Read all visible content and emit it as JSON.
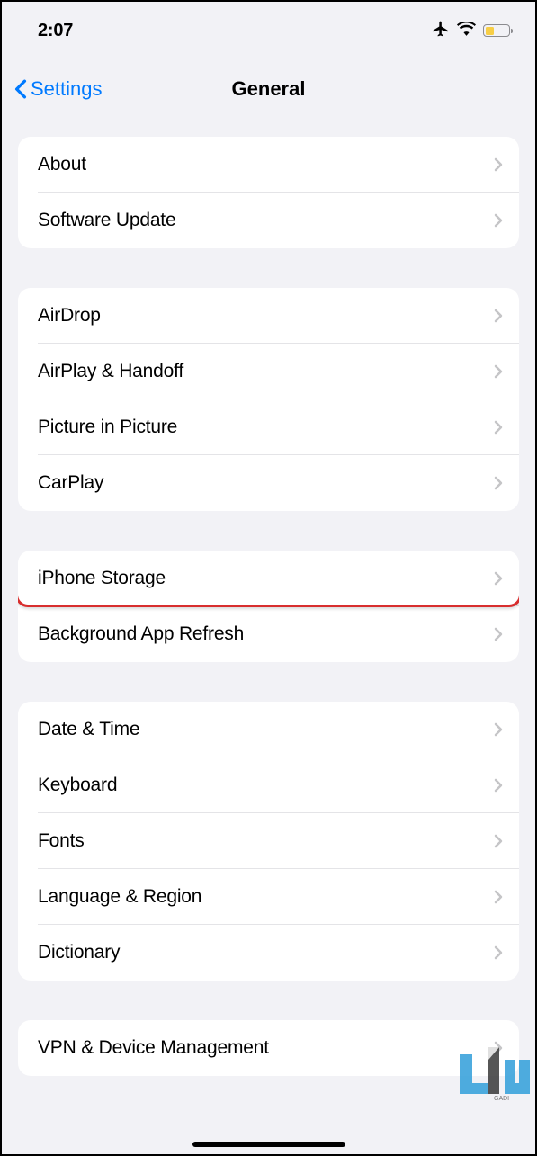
{
  "status": {
    "time": "2:07"
  },
  "nav": {
    "back_label": "Settings",
    "title": "General"
  },
  "groups": [
    {
      "items": [
        {
          "label": "About"
        },
        {
          "label": "Software Update"
        }
      ]
    },
    {
      "items": [
        {
          "label": "AirDrop"
        },
        {
          "label": "AirPlay & Handoff"
        },
        {
          "label": "Picture in Picture"
        },
        {
          "label": "CarPlay"
        }
      ]
    },
    {
      "items": [
        {
          "label": "iPhone Storage",
          "highlighted": true
        },
        {
          "label": "Background App Refresh"
        }
      ]
    },
    {
      "items": [
        {
          "label": "Date & Time"
        },
        {
          "label": "Keyboard"
        },
        {
          "label": "Fonts"
        },
        {
          "label": "Language & Region"
        },
        {
          "label": "Dictionary"
        }
      ]
    },
    {
      "items": [
        {
          "label": "VPN & Device Management"
        }
      ]
    }
  ]
}
